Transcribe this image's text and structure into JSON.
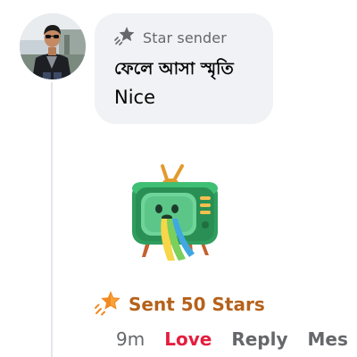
{
  "comment": {
    "sender_badge": "Star sender",
    "author_name": "ফেলে আসা স্মৃতি",
    "text": "Nice"
  },
  "stars": {
    "label": "Sent 50 Stars",
    "accent_color": "#b5621b"
  },
  "actions": {
    "time": "9m",
    "love": "Love",
    "reply": "Reply",
    "more": "Mes"
  },
  "icons": {
    "badge_icon": "star-sender-icon",
    "stars_icon": "stars-icon"
  },
  "colors": {
    "bubble_bg": "#f0f2f5",
    "love_red": "#e41e3f",
    "secondary_text": "#65676b"
  }
}
